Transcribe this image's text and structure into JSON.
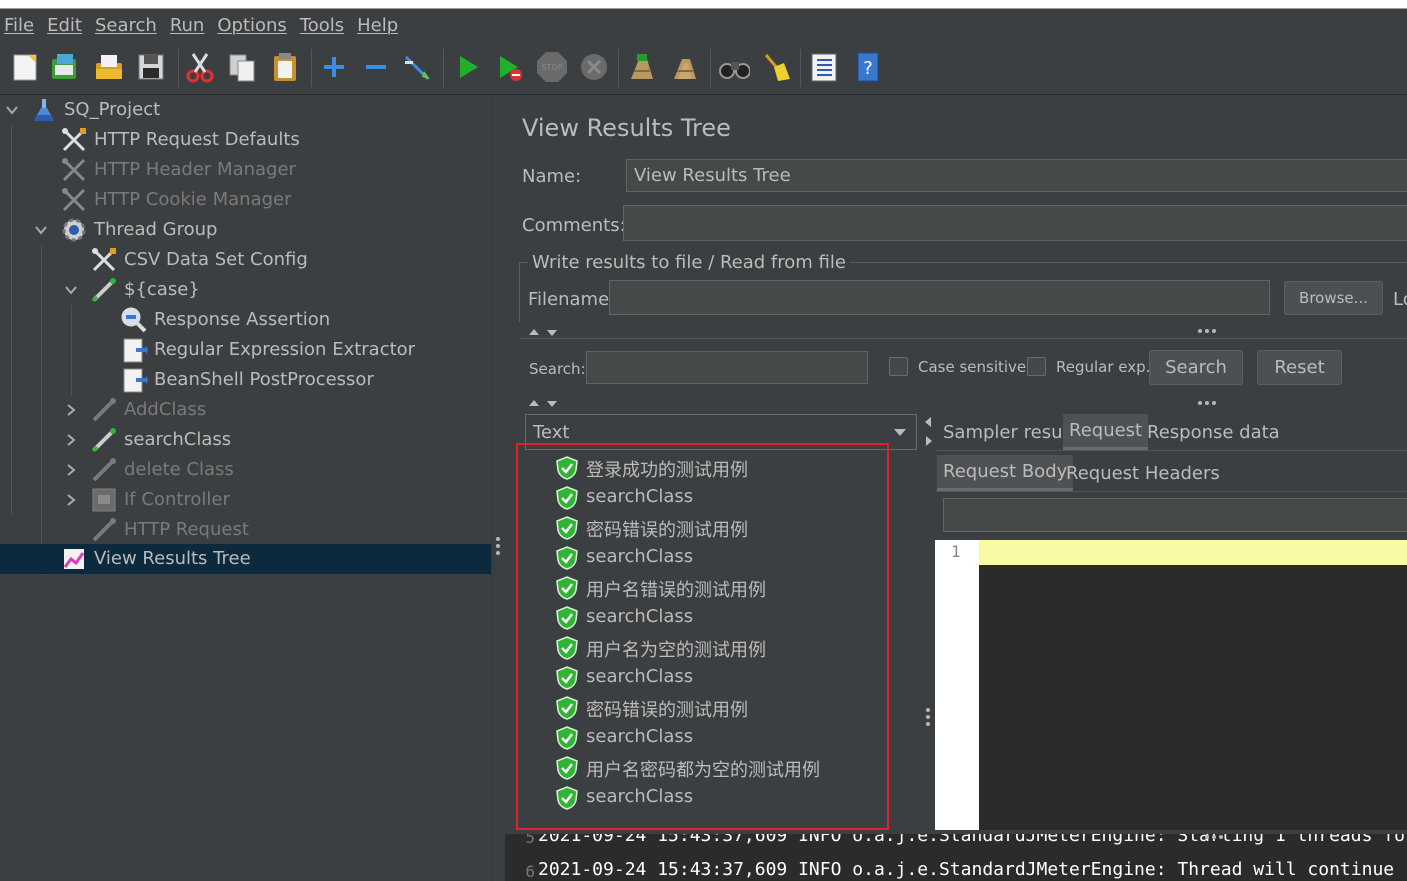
{
  "menubar": {
    "items": [
      "File",
      "Edit",
      "Search",
      "Run",
      "Options",
      "Tools",
      "Help"
    ]
  },
  "toolbar": {
    "icons": [
      "new-icon",
      "templates-icon",
      "open-icon",
      "save-icon",
      "cut-icon",
      "copy-icon",
      "paste-icon",
      "expand-icon",
      "collapse-icon",
      "toggle-icon",
      "start-icon",
      "start-no-pause-icon",
      "stop-icon",
      "shutdown-icon",
      "clear-icon",
      "clear-all-icon",
      "search-binoculars-icon",
      "reset-search-broom-icon",
      "function-helper-icon",
      "help-icon"
    ]
  },
  "tree": {
    "items": [
      {
        "label": "SQ_Project",
        "icon": "test-plan-flask-icon",
        "disabled": false
      },
      {
        "label": "HTTP Request Defaults",
        "icon": "config-wrench-icon",
        "disabled": false
      },
      {
        "label": "HTTP Header Manager",
        "icon": "config-wrench-icon",
        "disabled": true
      },
      {
        "label": "HTTP Cookie Manager",
        "icon": "config-wrench-icon",
        "disabled": true
      },
      {
        "label": "Thread Group",
        "icon": "thread-group-gear-icon",
        "disabled": false
      },
      {
        "label": "CSV Data Set Config",
        "icon": "config-wrench-icon",
        "disabled": false
      },
      {
        "label": "${case}",
        "icon": "sampler-pipette-icon",
        "disabled": false
      },
      {
        "label": "Response Assertion",
        "icon": "assertion-magnifier-icon",
        "disabled": false
      },
      {
        "label": "Regular Expression Extractor",
        "icon": "post-processor-page-icon",
        "disabled": false
      },
      {
        "label": "BeanShell PostProcessor",
        "icon": "post-processor-page-icon",
        "disabled": false
      },
      {
        "label": "AddClass",
        "icon": "sampler-pipette-icon",
        "disabled": true
      },
      {
        "label": "searchClass",
        "icon": "sampler-pipette-icon",
        "disabled": false
      },
      {
        "label": "delete Class",
        "icon": "sampler-pipette-icon",
        "disabled": true
      },
      {
        "label": "If Controller",
        "icon": "controller-icon",
        "disabled": true
      },
      {
        "label": "HTTP Request",
        "icon": "sampler-pipette-icon",
        "disabled": true
      },
      {
        "label": "View Results Tree",
        "icon": "listener-graph-icon",
        "disabled": false,
        "selected": true
      }
    ]
  },
  "panel": {
    "title": "View Results Tree",
    "name_label": "Name:",
    "name_value": "View Results Tree",
    "comments_label": "Comments:",
    "comments_value": "",
    "file_section_label": "Write results to file / Read from file",
    "filename_label": "Filename",
    "filename_value": "",
    "browse_label": "Browse...",
    "log_label": "Lo",
    "search_label": "Search:",
    "search_value": "",
    "case_sensitive_label": "Case sensitive",
    "regular_exp_label": "Regular exp.",
    "search_button": "Search",
    "reset_button": "Reset",
    "renderer_selected": "Text"
  },
  "results": [
    {
      "label": "登录成功的测试用例",
      "status": "success"
    },
    {
      "label": "searchClass",
      "status": "success"
    },
    {
      "label": "密码错误的测试用例",
      "status": "success"
    },
    {
      "label": "searchClass",
      "status": "success"
    },
    {
      "label": "用户名错误的测试用例",
      "status": "success"
    },
    {
      "label": "searchClass",
      "status": "success"
    },
    {
      "label": "用户名为空的测试用例",
      "status": "success"
    },
    {
      "label": "searchClass",
      "status": "success"
    },
    {
      "label": "密码错误的测试用例",
      "status": "success"
    },
    {
      "label": "searchClass",
      "status": "success"
    },
    {
      "label": "用户名密码都为空的测试用例",
      "status": "success"
    },
    {
      "label": "searchClass",
      "status": "success"
    }
  ],
  "tabs": {
    "main": [
      "Sampler result",
      "Request",
      "Response data"
    ],
    "main_active": "Request",
    "sub": [
      "Request Body",
      "Request Headers"
    ],
    "sub_active": "Request Body"
  },
  "editor": {
    "line_number": "1"
  },
  "log": {
    "lines": [
      {
        "num": "5",
        "text": "2021-09-24 15:43:37,609 INFO o.a.j.e.StandardJMeterEngine: Starting 1 threads fo"
      },
      {
        "num": "6",
        "text": "2021-09-24 15:43:37,609 INFO o.a.j.e.StandardJMeterEngine: Thread will continue"
      }
    ]
  },
  "colors": {
    "background": "#3c3f41",
    "selection": "#0d293e",
    "highlight_box": "#e0202a",
    "success_green": "#2fb533",
    "editor_current_line": "#fafaa5"
  }
}
